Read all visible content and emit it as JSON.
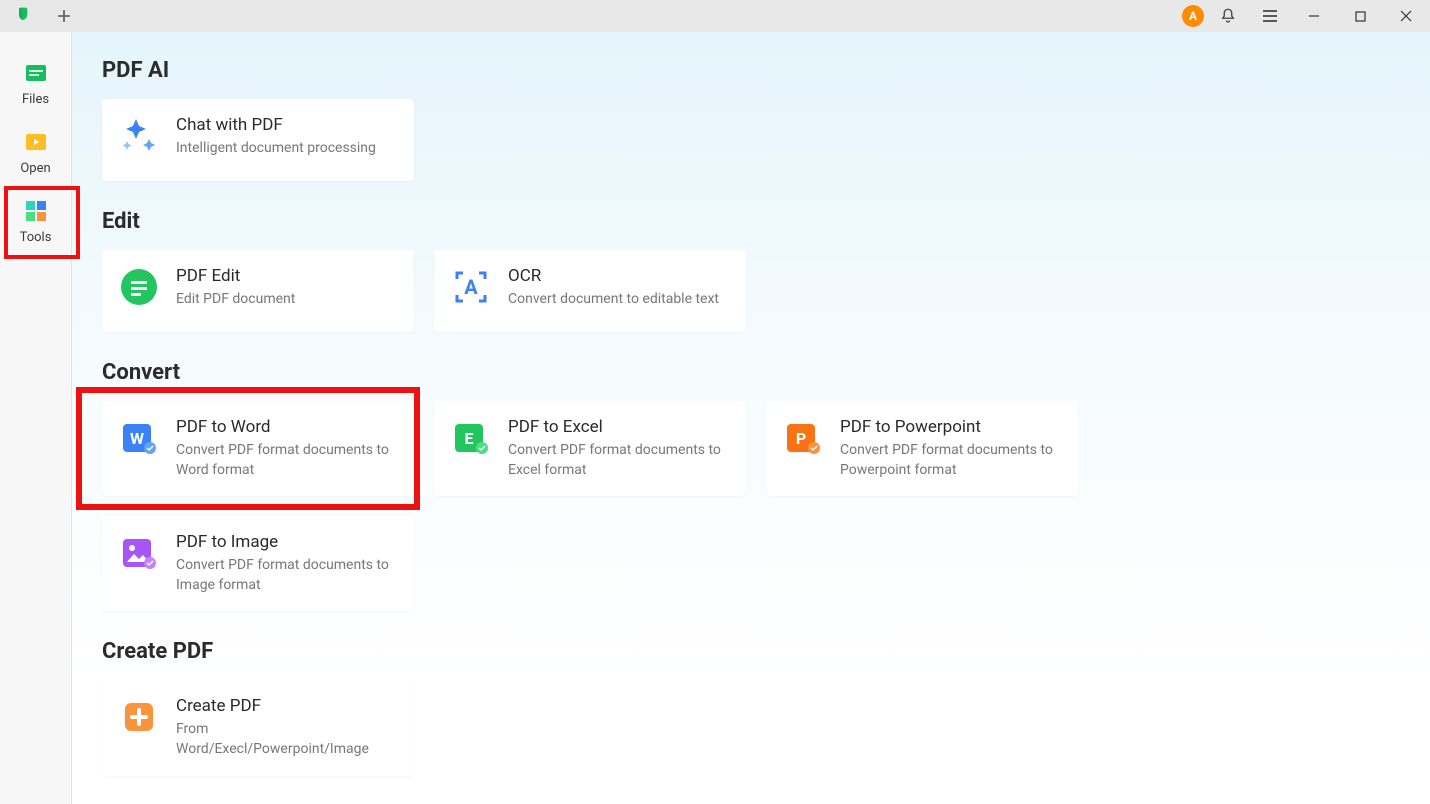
{
  "titlebar": {
    "avatar_initial": "A"
  },
  "sidebar": {
    "items": [
      {
        "label": "Files",
        "icon": "files"
      },
      {
        "label": "Open",
        "icon": "open"
      },
      {
        "label": "Tools",
        "icon": "tools",
        "highlighted": true
      }
    ]
  },
  "sections": [
    {
      "title": "PDF AI",
      "cards": [
        {
          "title": "Chat with PDF",
          "desc": "Intelligent document processing",
          "icon": "chat-ai"
        }
      ]
    },
    {
      "title": "Edit",
      "cards": [
        {
          "title": "PDF Edit",
          "desc": "Edit PDF document",
          "icon": "pdf-edit"
        },
        {
          "title": "OCR",
          "desc": "Convert document to editable text",
          "icon": "ocr"
        }
      ]
    },
    {
      "title": "Convert",
      "cards": [
        {
          "title": "PDF to Word",
          "desc": "Convert PDF format documents to Word format",
          "icon": "word",
          "highlighted": true
        },
        {
          "title": "PDF to Excel",
          "desc": "Convert PDF format documents to Excel format",
          "icon": "excel"
        },
        {
          "title": "PDF to Powerpoint",
          "desc": "Convert PDF format documents to Powerpoint format",
          "icon": "ppt"
        },
        {
          "title": "PDF to Image",
          "desc": "Convert PDF format documents to Image format",
          "icon": "image"
        }
      ]
    },
    {
      "title": "Create PDF",
      "cards": [
        {
          "title": "Create PDF",
          "desc": "From Word/Execl/Powerpoint/Image",
          "icon": "create"
        }
      ]
    }
  ]
}
